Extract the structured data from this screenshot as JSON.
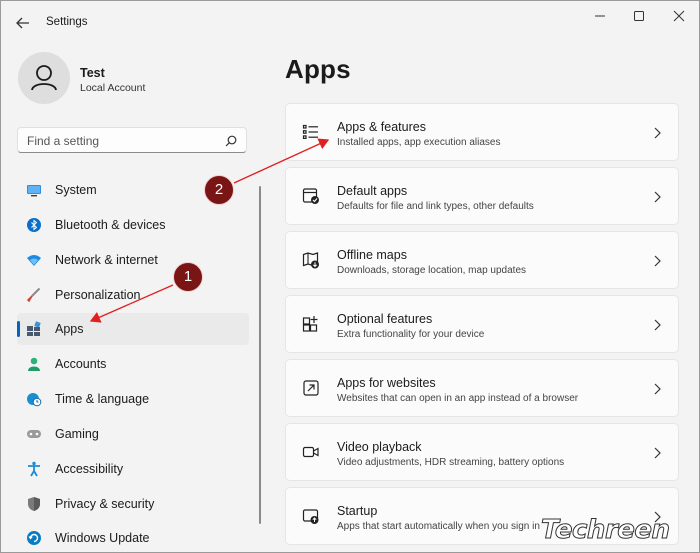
{
  "window": {
    "title": "Settings",
    "icons": {
      "back": "arrow-left-icon",
      "minimize": "minimize-icon",
      "maximize": "maximize-icon",
      "close": "close-icon"
    }
  },
  "profile": {
    "name": "Test",
    "account_type": "Local Account"
  },
  "search": {
    "placeholder": "Find a setting",
    "icon": "search-icon"
  },
  "sidebar": {
    "active_index": 4,
    "items": [
      {
        "label": "System",
        "icon": "system-monitor-icon",
        "color": "#0078d4"
      },
      {
        "label": "Bluetooth & devices",
        "icon": "bluetooth-icon",
        "color": "#0067c0"
      },
      {
        "label": "Network & internet",
        "icon": "wifi-icon",
        "color": "#0078d4"
      },
      {
        "label": "Personalization",
        "icon": "brush-icon",
        "color": "#c0392b"
      },
      {
        "label": "Apps",
        "icon": "apps-icon",
        "color": "#3a6ea5"
      },
      {
        "label": "Accounts",
        "icon": "person-icon",
        "color": "#2bb37a"
      },
      {
        "label": "Time & language",
        "icon": "globe-clock-icon",
        "color": "#0a84c6"
      },
      {
        "label": "Gaming",
        "icon": "gamepad-icon",
        "color": "#7a7a7a"
      },
      {
        "label": "Accessibility",
        "icon": "accessibility-icon",
        "color": "#1c8bd6"
      },
      {
        "label": "Privacy & security",
        "icon": "shield-icon",
        "color": "#6b6b6b"
      },
      {
        "label": "Windows Update",
        "icon": "update-icon",
        "color": "#0a7cc4"
      }
    ]
  },
  "main": {
    "title": "Apps",
    "cards": [
      {
        "title": "Apps & features",
        "desc": "Installed apps, app execution aliases",
        "icon": "list-icon"
      },
      {
        "title": "Default apps",
        "desc": "Defaults for file and link types, other defaults",
        "icon": "default-apps-icon"
      },
      {
        "title": "Offline maps",
        "desc": "Downloads, storage location, map updates",
        "icon": "map-icon"
      },
      {
        "title": "Optional features",
        "desc": "Extra functionality for your device",
        "icon": "add-grid-icon"
      },
      {
        "title": "Apps for websites",
        "desc": "Websites that can open in an app instead of a browser",
        "icon": "open-link-icon"
      },
      {
        "title": "Video playback",
        "desc": "Video adjustments, HDR streaming, battery options",
        "icon": "video-icon"
      },
      {
        "title": "Startup",
        "desc": "Apps that start automatically when you sign in",
        "icon": "startup-icon"
      }
    ]
  },
  "annotations": {
    "step1": "1",
    "step2": "2",
    "arrow_color": "#e02020",
    "badge_color": "#7a1515"
  },
  "watermark": "Techreen"
}
